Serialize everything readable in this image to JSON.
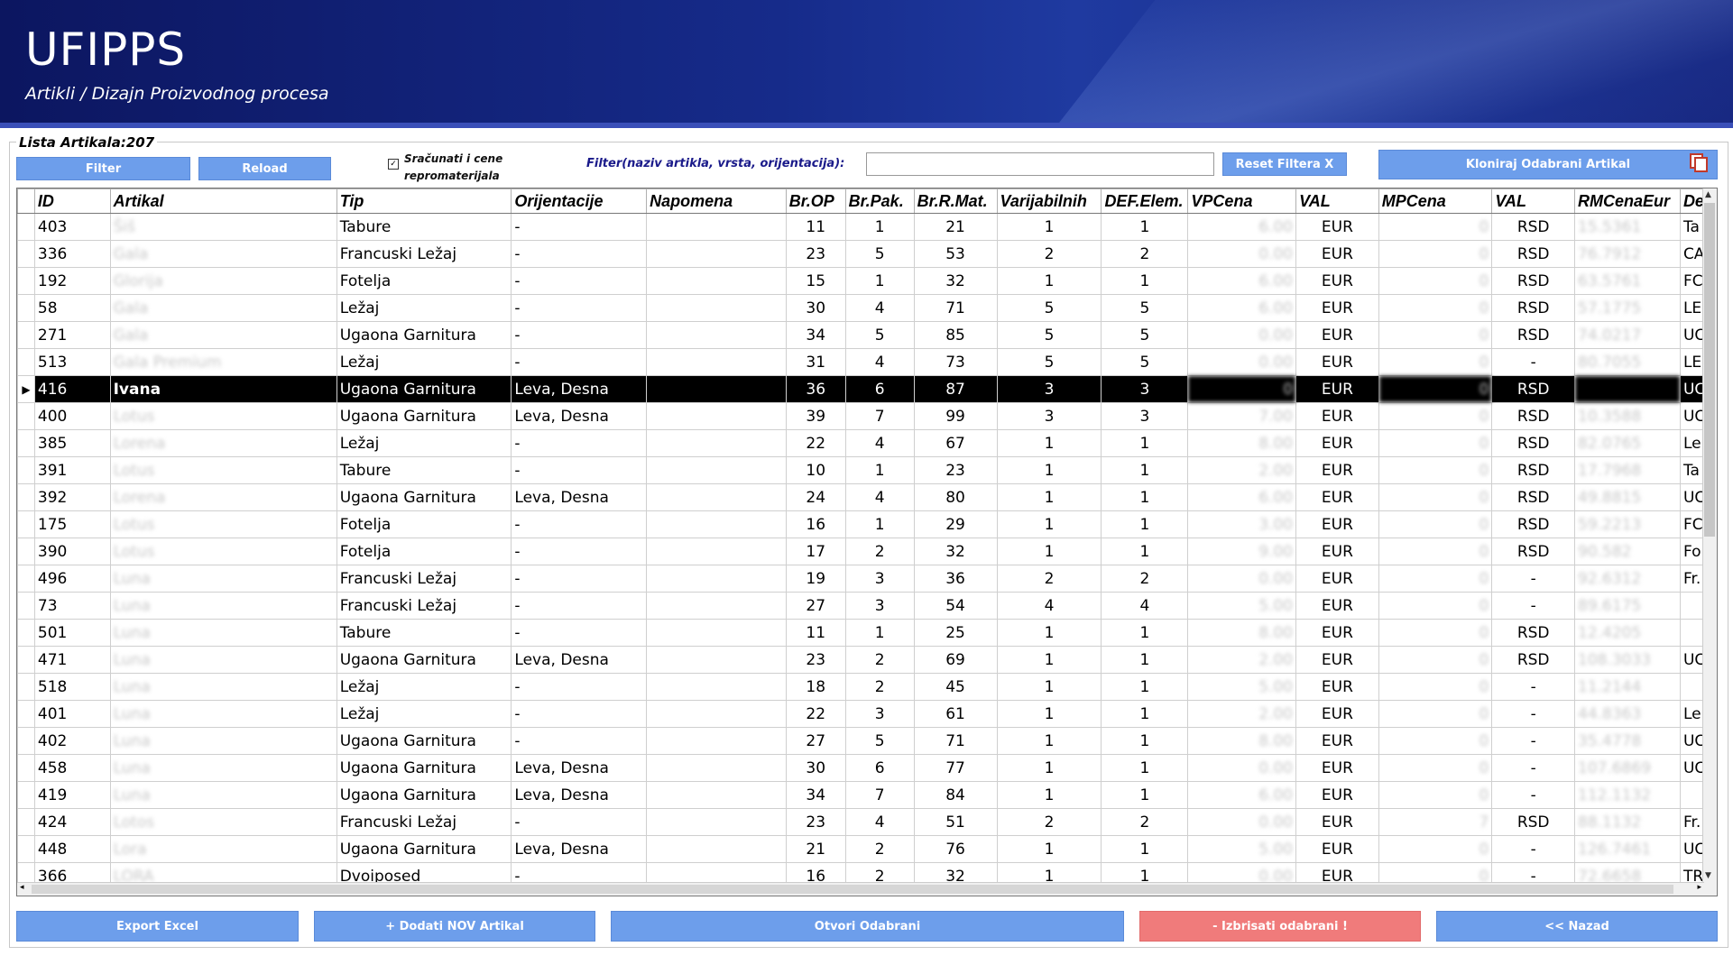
{
  "app": {
    "title": "UFIPPS",
    "subtitle": "Artikli / Dizajn Proizvodnog procesa"
  },
  "list": {
    "count_label": "Lista Artikala:207"
  },
  "toolbar": {
    "filter_btn": "Filter",
    "reload_btn": "Reload",
    "checkbox_label": "Sračunati i cene repromaterijala",
    "checkbox_checked": true,
    "filter_label": "Filter(naziv artikla, vrsta, orijentacija):",
    "filter_value": "",
    "reset_btn": "Reset Filtera X",
    "clone_btn": "Kloniraj Odabrani Artikal"
  },
  "table": {
    "columns": [
      "ID",
      "Artikal",
      "Tip",
      "Orijentacije",
      "Napomena",
      "Br.OP",
      "Br.Pak.",
      "Br.R.Mat.",
      "Varijabilnih",
      "DEF.Elem.",
      "VPCena",
      "VAL",
      "MPCena",
      "VAL",
      "RMCenaEur",
      "De"
    ],
    "rows": [
      [
        "403",
        "Šiš",
        "Tabure",
        "-",
        "",
        "11",
        "1",
        "21",
        "1",
        "1",
        "6.00",
        "EUR",
        "0",
        "RSD",
        "15.5361",
        "Ta"
      ],
      [
        "336",
        "Gala",
        "Francuski Ležaj",
        "-",
        "",
        "23",
        "5",
        "53",
        "2",
        "2",
        "0.00",
        "EUR",
        "0",
        "RSD",
        "76.7912",
        "CA"
      ],
      [
        "192",
        "Glorija",
        "Fotelja",
        "-",
        "",
        "15",
        "1",
        "32",
        "1",
        "1",
        "6.00",
        "EUR",
        "0",
        "RSD",
        "63.5761",
        "FC"
      ],
      [
        "58",
        "Gala",
        "Ležaj",
        "-",
        "",
        "30",
        "4",
        "71",
        "5",
        "5",
        "6.00",
        "EUR",
        "0",
        "RSD",
        "57.1775",
        "LE"
      ],
      [
        "271",
        "Gala",
        "Ugaona Garnitura",
        "-",
        "",
        "34",
        "5",
        "85",
        "5",
        "5",
        "0.00",
        "EUR",
        "0",
        "RSD",
        "74.0217",
        "UC"
      ],
      [
        "513",
        "Gala Premium",
        "Ležaj",
        "-",
        "",
        "31",
        "4",
        "73",
        "5",
        "5",
        "0.00",
        "EUR",
        "0",
        "-",
        "80.7055",
        "LE"
      ],
      [
        "416",
        "Ivana",
        "Ugaona Garnitura",
        "Leva, Desna",
        "",
        "36",
        "6",
        "87",
        "3",
        "3",
        "0",
        "EUR",
        "0",
        "RSD",
        "",
        "UC"
      ],
      [
        "400",
        "Lotus",
        "Ugaona Garnitura",
        "Leva, Desna",
        "",
        "39",
        "7",
        "99",
        "3",
        "3",
        "7.00",
        "EUR",
        "0",
        "RSD",
        "10.3588",
        "UC"
      ],
      [
        "385",
        "Lorena",
        "Ležaj",
        "-",
        "",
        "22",
        "4",
        "67",
        "1",
        "1",
        "8.00",
        "EUR",
        "0",
        "RSD",
        "82.0765",
        "Le"
      ],
      [
        "391",
        "Lotus",
        "Tabure",
        "-",
        "",
        "10",
        "1",
        "23",
        "1",
        "1",
        "2.00",
        "EUR",
        "0",
        "RSD",
        "17.7968",
        "Ta"
      ],
      [
        "392",
        "Lorena",
        "Ugaona Garnitura",
        "Leva, Desna",
        "",
        "24",
        "4",
        "80",
        "1",
        "1",
        "6.00",
        "EUR",
        "0",
        "RSD",
        "49.8815",
        "UC"
      ],
      [
        "175",
        "Lotus",
        "Fotelja",
        "-",
        "",
        "16",
        "1",
        "29",
        "1",
        "1",
        "3.00",
        "EUR",
        "0",
        "RSD",
        "59.2213",
        "FC"
      ],
      [
        "390",
        "Lotus",
        "Fotelja",
        "-",
        "",
        "17",
        "2",
        "32",
        "1",
        "1",
        "9.00",
        "EUR",
        "0",
        "RSD",
        "90.582",
        "Fo"
      ],
      [
        "496",
        "Luna",
        "Francuski Ležaj",
        "-",
        "",
        "19",
        "3",
        "36",
        "2",
        "2",
        "0.00",
        "EUR",
        "0",
        "-",
        "92.6312",
        "Fr."
      ],
      [
        "73",
        "Luna",
        "Francuski Ležaj",
        "-",
        "",
        "27",
        "3",
        "54",
        "4",
        "4",
        "5.00",
        "EUR",
        "0",
        "-",
        "89.6175",
        ""
      ],
      [
        "501",
        "Luna",
        "Tabure",
        "-",
        "",
        "11",
        "1",
        "25",
        "1",
        "1",
        "8.00",
        "EUR",
        "0",
        "RSD",
        "12.4205",
        ""
      ],
      [
        "471",
        "Luna",
        "Ugaona Garnitura",
        "Leva, Desna",
        "",
        "23",
        "2",
        "69",
        "1",
        "1",
        "2.00",
        "EUR",
        "0",
        "RSD",
        "108.3033",
        "UC"
      ],
      [
        "518",
        "Luna",
        "Ležaj",
        "-",
        "",
        "18",
        "2",
        "45",
        "1",
        "1",
        "5.00",
        "EUR",
        "0",
        "-",
        "11.2144",
        ""
      ],
      [
        "401",
        "Luna",
        "Ležaj",
        "-",
        "",
        "22",
        "3",
        "61",
        "1",
        "1",
        "2.00",
        "EUR",
        "0",
        "-",
        "44.8363",
        "Le"
      ],
      [
        "402",
        "Luna",
        "Ugaona Garnitura",
        "-",
        "",
        "27",
        "5",
        "71",
        "1",
        "1",
        "8.00",
        "EUR",
        "0",
        "-",
        "35.4778",
        "UC"
      ],
      [
        "458",
        "Luna",
        "Ugaona Garnitura",
        "Leva, Desna",
        "",
        "30",
        "6",
        "77",
        "1",
        "1",
        "0.00",
        "EUR",
        "0",
        "-",
        "107.6869",
        "UC"
      ],
      [
        "419",
        "Luna",
        "Ugaona Garnitura",
        "Leva, Desna",
        "",
        "34",
        "7",
        "84",
        "1",
        "1",
        "6.00",
        "EUR",
        "0",
        "-",
        "112.1132",
        ""
      ],
      [
        "424",
        "Lotos",
        "Francuski Ležaj",
        "-",
        "",
        "23",
        "4",
        "51",
        "2",
        "2",
        "0.00",
        "EUR",
        "7",
        "RSD",
        "88.1132",
        "Fr."
      ],
      [
        "448",
        "Lora",
        "Ugaona Garnitura",
        "Leva, Desna",
        "",
        "21",
        "2",
        "76",
        "1",
        "1",
        "5.00",
        "EUR",
        "0",
        "-",
        "126.7461",
        "UC"
      ],
      [
        "366",
        "LORA",
        "Dvoiposed",
        "-",
        "",
        "16",
        "2",
        "32",
        "1",
        "1",
        "0.00",
        "EUR",
        "0",
        "-",
        "72.6658",
        "TR"
      ]
    ],
    "selected_row": 6
  },
  "footer": {
    "export_btn": "Export Excel",
    "add_btn": "+ Dodati NOV Artikal",
    "open_btn": "Otvori Odabrani",
    "delete_btn": "- Izbrisati odabrani !",
    "back_btn": "<< Nazad"
  },
  "colors": {
    "button": "#6d9eeb",
    "danger": "#f07b7b",
    "banner": "#162b8a",
    "selected_row": "#000000"
  },
  "icons": {
    "clone": "copy-icon",
    "row_pointer": "caret-right-icon",
    "sort_up": "chevron-up-icon",
    "scroll_down": "chevron-down-icon"
  }
}
